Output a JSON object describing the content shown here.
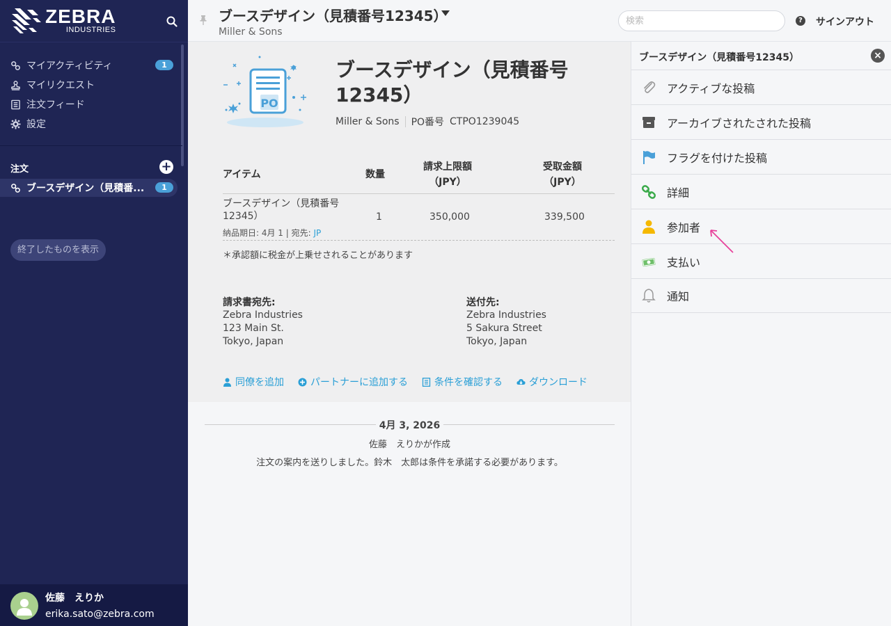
{
  "brand": {
    "name": "ZEBRA",
    "sub": "INDUSTRIES"
  },
  "sidebar": {
    "nav": [
      {
        "label": "マイアクティビティ",
        "icon": "link-icon",
        "badge": "1"
      },
      {
        "label": "マイリクエスト",
        "icon": "stamp-icon"
      },
      {
        "label": "注文フィード",
        "icon": "feed-icon"
      },
      {
        "label": "設定",
        "icon": "gear-icon"
      }
    ],
    "orders_header": "注文",
    "order_item": {
      "label": "ブースデザイン（見積番...",
      "badge": "1"
    },
    "show_done": "終了したものを表示",
    "user": {
      "name": "佐藤　えりか",
      "email": "erika.sato@zebra.com"
    }
  },
  "topbar": {
    "title": "ブースデザイン（見積番号12345）",
    "subtitle": "Miller & Sons",
    "search_placeholder": "検索",
    "signout": "サインアウト"
  },
  "main": {
    "title": "ブースデザイン（見積番号12345）",
    "meta": {
      "company": "Miller & Sons",
      "po_label": "PO番号",
      "po_number": "CTPO1239045"
    },
    "table": {
      "headers": {
        "item": "アイテム",
        "qty": "数量",
        "limit": "請求上限額",
        "limit_unit": "（JPY）",
        "received": "受取金額",
        "received_unit": "（JPY）"
      },
      "row": {
        "item_line1": "ブースデザイン（見積番号",
        "item_line2": "12345）",
        "qty": "1",
        "limit": "350,000",
        "received": "339,500",
        "delivery": "納品期日: 4月 1 | 宛先:",
        "dest": "JP"
      },
      "note": "＊承認額に税金が上乗せされることがあります"
    },
    "billing": {
      "header": "請求書宛先:",
      "lines": [
        "Zebra Industries",
        "123 Main St.",
        "Tokyo, Japan"
      ]
    },
    "shipping": {
      "header": "送付先:",
      "lines": [
        "Zebra Industries",
        "5 Sakura Street",
        "Tokyo, Japan"
      ]
    },
    "actions": [
      "同僚を追加",
      "パートナーに追加する",
      "条件を確認する",
      "ダウンロード"
    ],
    "feed": {
      "date": "4月 3, 2026",
      "created": "佐藤　えりかが作成",
      "message": "注文の案内を送りしました。鈴木　太郎は条件を承諾する必要があります。"
    }
  },
  "right_panel": {
    "title": "ブースデザイン（見積番号12345）",
    "items": [
      {
        "label": "アクティブな投稿",
        "icon": "paperclip-icon"
      },
      {
        "label": "アーカイブされたされた投稿",
        "icon": "archive-icon"
      },
      {
        "label": "フラグを付けた投稿",
        "icon": "flag-icon"
      },
      {
        "label": "詳細",
        "icon": "chain-link-icon"
      },
      {
        "label": "参加者",
        "icon": "person-icon"
      },
      {
        "label": "支払い",
        "icon": "money-icon"
      },
      {
        "label": "通知",
        "icon": "bell-icon"
      }
    ]
  },
  "colors": {
    "sidebar": "#1f2554",
    "accent": "#2a9fd6",
    "badge": "#4aa0d8",
    "arrow": "#e8409a"
  }
}
